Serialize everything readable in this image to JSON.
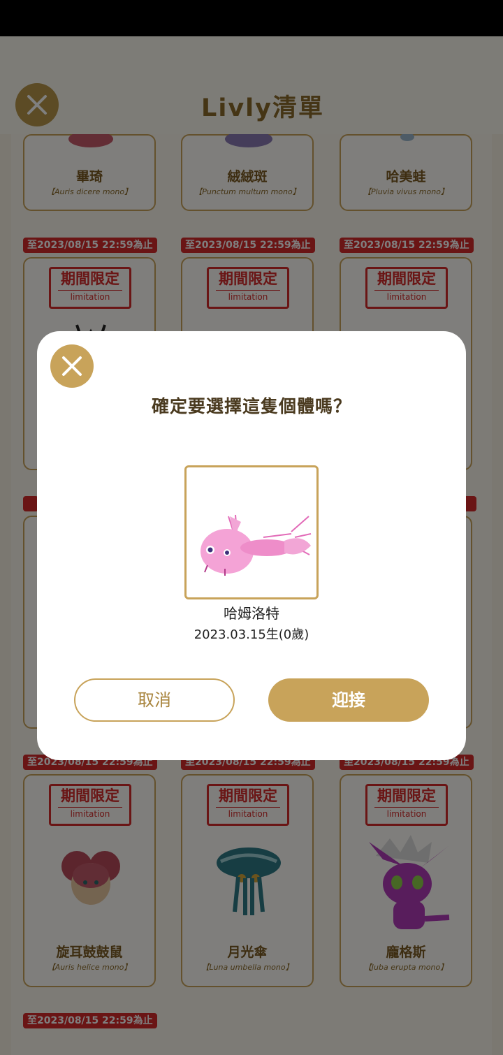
{
  "header": {
    "title": "Livly清單",
    "close_icon": "close-icon"
  },
  "deadline_text": "至2023/08/15 22:59為止",
  "limit_badge": {
    "title": "期間限定",
    "subtitle": "limitation"
  },
  "top_row": [
    {
      "name": "畢琦",
      "sci": "【Auris dicere mono】"
    },
    {
      "name": "絨絨斑",
      "sci": "【Punctum multum mono】"
    },
    {
      "name": "哈美蛙",
      "sci": "【Pluvia vivus mono】"
    }
  ],
  "bottom_row": [
    {
      "name": "旋耳鼓鼓鼠",
      "sci": "【Auris helice mono】"
    },
    {
      "name": "月光傘",
      "sci": "【Luna umbella mono】"
    },
    {
      "name": "龐格斯",
      "sci": "【Juba erupta mono】"
    }
  ],
  "dialog": {
    "title": "確定要選擇這隻個體嗎？",
    "creature_name": "哈姆洛特",
    "birth": "2023.03.15生(0歲)",
    "cancel_label": "取消",
    "accept_label": "迎接"
  },
  "colors": {
    "gold": "#c8a35a",
    "red": "#d42a2a",
    "overlay": "rgba(0,0,0,0.5)"
  }
}
